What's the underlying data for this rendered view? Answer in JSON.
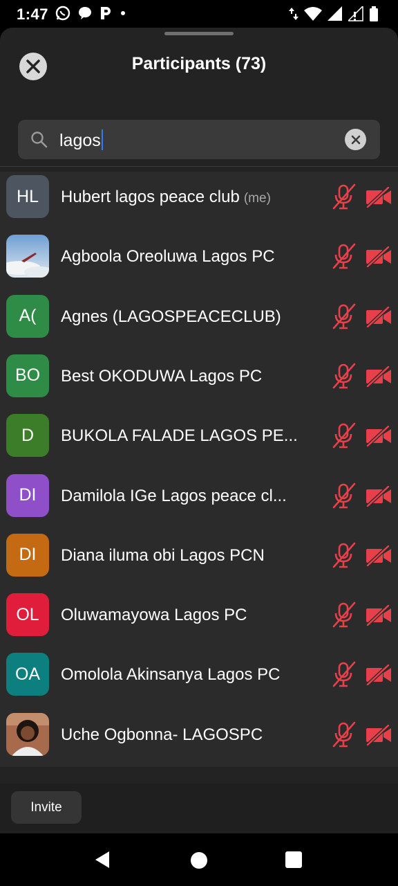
{
  "status": {
    "time": "1:47"
  },
  "header": {
    "title": "Participants (73)"
  },
  "search": {
    "value": "lagos"
  },
  "participants": [
    {
      "initials": "HL",
      "name": "Hubert lagos peace club",
      "tag": "(me)",
      "color": "#4d5560",
      "photo": false
    },
    {
      "initials": "",
      "name": "Agboola Oreoluwa Lagos PC",
      "color": "#8fb2d6",
      "photo": true
    },
    {
      "initials": "A(",
      "name": "Agnes (LAGOSPEACECLUB)",
      "color": "#2e8c46",
      "photo": false
    },
    {
      "initials": "BO",
      "name": "Best OKODUWA Lagos PC",
      "color": "#2e8c46",
      "photo": false
    },
    {
      "initials": "D",
      "name": "BUKOLA FALADE LAGOS PE...",
      "color": "#3c7d2a",
      "photo": false
    },
    {
      "initials": "DI",
      "name": "Damilola IGe Lagos peace cl...",
      "color": "#8f4fc9",
      "photo": false
    },
    {
      "initials": "DI",
      "name": "Diana iluma obi Lagos PCN",
      "color": "#c46a12",
      "photo": false
    },
    {
      "initials": "OL",
      "name": "Oluwamayowa Lagos PC",
      "color": "#e01d3b",
      "photo": false
    },
    {
      "initials": "OA",
      "name": "Omolola Akinsanya Lagos PC",
      "color": "#0d7f7f",
      "photo": false
    },
    {
      "initials": "",
      "name": "Uche Ogbonna- LAGOSPC",
      "color": "#b77a5a",
      "photo": true
    }
  ],
  "icons": {
    "muted_mic": "mic-off-icon",
    "video_off": "video-off-icon",
    "status_color": "#e8404a"
  },
  "footer": {
    "invite_label": "Invite"
  }
}
